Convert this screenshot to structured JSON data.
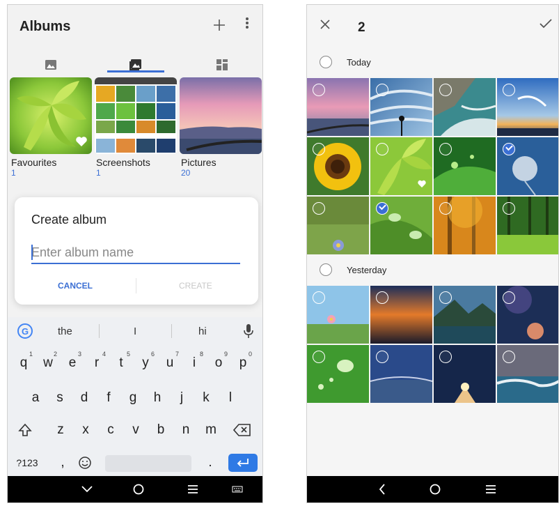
{
  "left": {
    "header": {
      "title": "Albums",
      "add_icon": "plus-icon",
      "more_icon": "more-vert-icon"
    },
    "tabs": [
      {
        "icon": "image-icon",
        "active": false
      },
      {
        "icon": "albums-icon",
        "active": true
      },
      {
        "icon": "collage-icon",
        "active": false
      }
    ],
    "albums": [
      {
        "name": "Favourites",
        "count": "1"
      },
      {
        "name": "Screenshots",
        "count": "1"
      },
      {
        "name": "Pictures",
        "count": "20"
      }
    ],
    "dialog": {
      "title": "Create album",
      "placeholder": "Enter album name",
      "cancel": "CANCEL",
      "create": "CREATE"
    },
    "keyboard": {
      "suggestions": [
        "the",
        "I",
        "hi"
      ],
      "row1": [
        {
          "k": "q",
          "n": "1"
        },
        {
          "k": "w",
          "n": "2"
        },
        {
          "k": "e",
          "n": "3"
        },
        {
          "k": "r",
          "n": "4"
        },
        {
          "k": "t",
          "n": "5"
        },
        {
          "k": "y",
          "n": "6"
        },
        {
          "k": "u",
          "n": "7"
        },
        {
          "k": "i",
          "n": "8"
        },
        {
          "k": "o",
          "n": "9"
        },
        {
          "k": "p",
          "n": "0"
        }
      ],
      "row2": [
        "a",
        "s",
        "d",
        "f",
        "g",
        "h",
        "j",
        "k",
        "l"
      ],
      "row3": [
        "z",
        "x",
        "c",
        "v",
        "b",
        "n",
        "m"
      ],
      "symbols": "?123",
      "comma": ",",
      "period": ".",
      "emoji_icon": "emoji-icon",
      "shift_icon": "shift-icon",
      "backspace_icon": "backspace-icon",
      "enter_icon": "enter-icon"
    }
  },
  "right": {
    "header": {
      "selected_count": "2",
      "close_icon": "close-icon",
      "confirm_icon": "check-icon"
    },
    "sections": [
      {
        "label": "Today"
      },
      {
        "label": "Yesterday"
      }
    ]
  },
  "colors": {
    "accent": "#3b6fd4",
    "enter_key": "#2f7ae5",
    "navbar": "#000000"
  }
}
